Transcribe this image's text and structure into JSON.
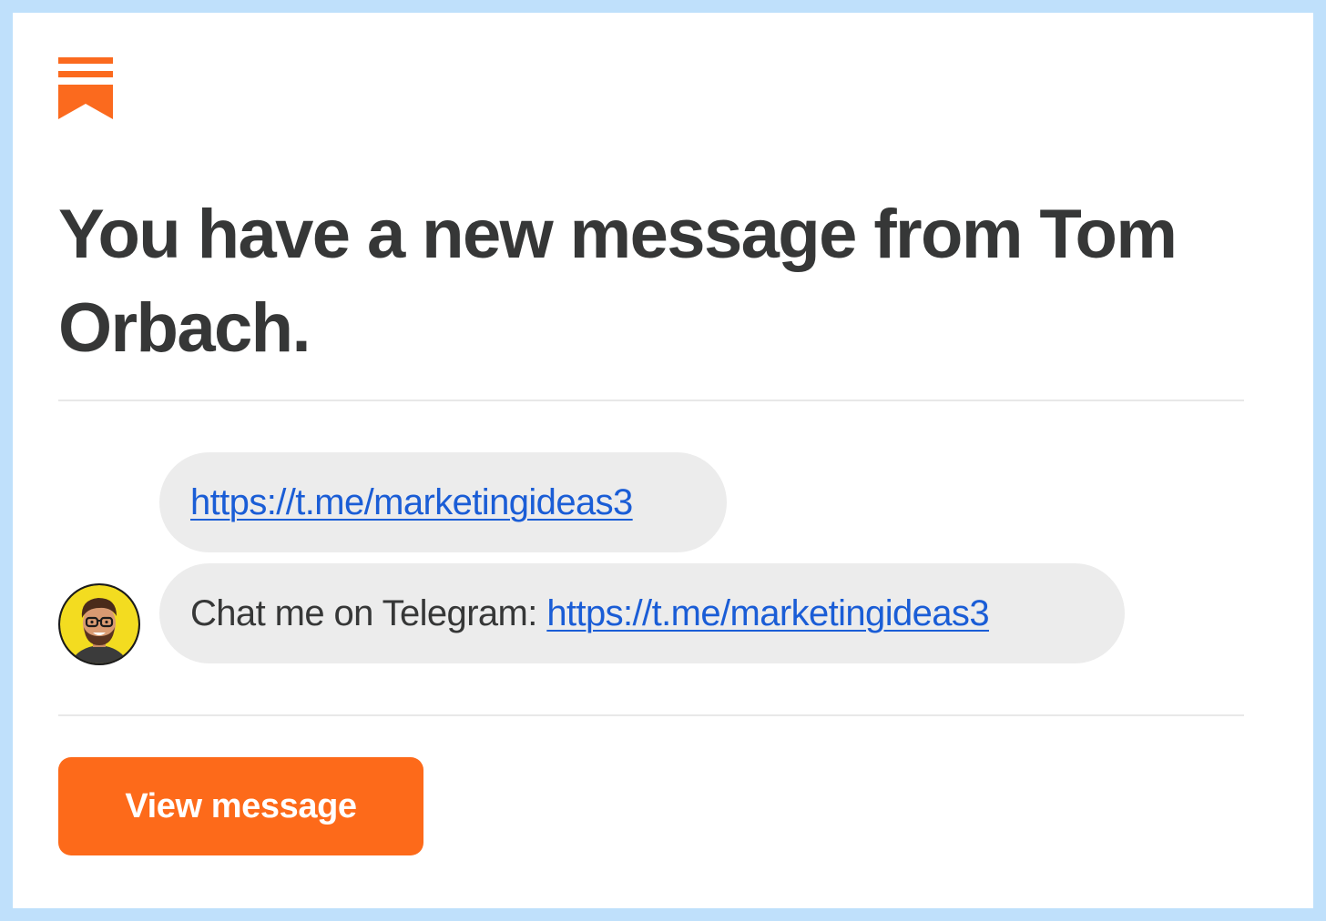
{
  "brand": {
    "icon": "substack-bookmark-icon",
    "color": "#ff6719"
  },
  "notification": {
    "headline": "You have a new message from Tom Orbach."
  },
  "messages": [
    {
      "prefix": "",
      "link": "https://t.me/marketingideas3"
    },
    {
      "prefix": "Chat me on Telegram: ",
      "link": "https://t.me/marketingideas3"
    }
  ],
  "sender": {
    "avatar": "avatar-icon"
  },
  "actions": {
    "view_label": "View message"
  },
  "colors": {
    "page_background": "#bfe0fb",
    "card_background": "#ffffff",
    "bubble": "#ececec",
    "link": "#1a5dd6",
    "button": "#fd6a1a",
    "headline": "#363737"
  }
}
